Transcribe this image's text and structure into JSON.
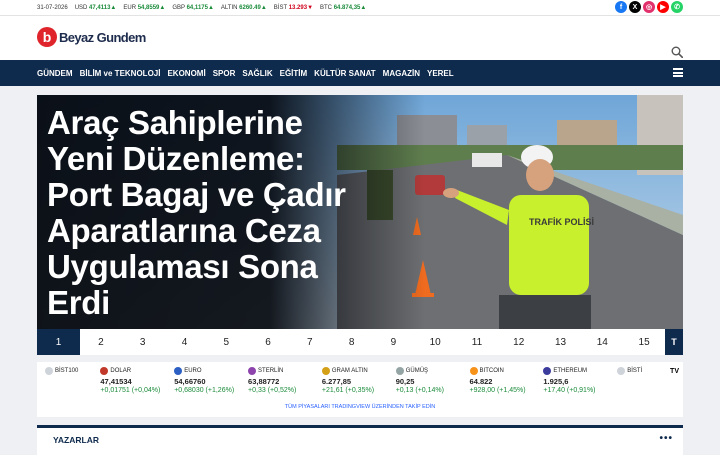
{
  "topbar": {
    "date": "31-07-2026",
    "tickers": [
      {
        "label": "USD",
        "value": "47,4113",
        "trend": "up"
      },
      {
        "label": "EUR",
        "value": "54,8559",
        "trend": "up"
      },
      {
        "label": "GBP",
        "value": "64,1175",
        "trend": "up"
      },
      {
        "label": "ALTIN",
        "value": "6260.49",
        "trend": "up"
      },
      {
        "label": "BİST",
        "value": "13.293",
        "trend": "down"
      },
      {
        "label": "BTC",
        "value": "64.874,35",
        "trend": "up"
      }
    ],
    "socials": [
      {
        "name": "facebook",
        "glyph": "f",
        "color": "#1877f2"
      },
      {
        "name": "x",
        "glyph": "X",
        "color": "#000000"
      },
      {
        "name": "instagram",
        "glyph": "◎",
        "color": "#e1306c"
      },
      {
        "name": "youtube",
        "glyph": "▶",
        "color": "#ff0000"
      },
      {
        "name": "whatsapp",
        "glyph": "✆",
        "color": "#25d366"
      }
    ]
  },
  "header": {
    "logo_letter": "b",
    "logo_text": "Beyaz Gundem",
    "search_icon": "search-icon"
  },
  "nav": {
    "items": [
      "GÜNDEM",
      "BİLİM ve TEKNOLOJİ",
      "EKONOMİ",
      "SPOR",
      "SAĞLIK",
      "EĞİTİM",
      "KÜLTÜR SANAT",
      "MAGAZİN",
      "YEREL"
    ],
    "menu_icon": "hamburger-icon"
  },
  "hero": {
    "title": "Araç Sahiplerine Yeni Düzenleme: Port Bagaj ve Çadır Aparatlarına Ceza Uygulaması Sona Erdi",
    "image_text": "TRAFİK POLİSİ"
  },
  "pager": {
    "pages": [
      "1",
      "2",
      "3",
      "4",
      "5",
      "6",
      "7",
      "8",
      "9",
      "10",
      "11",
      "12",
      "13",
      "14",
      "15"
    ],
    "active": "1",
    "end_label": "T"
  },
  "market": {
    "items": [
      {
        "name": "BİST100",
        "price": "",
        "change": "",
        "color": "#cfd3da"
      },
      {
        "name": "DOLAR",
        "price": "47,41534",
        "change": "+0,01751 (+0,04%)",
        "color": "#c0392b"
      },
      {
        "name": "EURO",
        "price": "54,66760",
        "change": "+0,68030 (+1,26%)",
        "color": "#2c5fc4"
      },
      {
        "name": "STERLİN",
        "price": "63,88772",
        "change": "+0,33 (+0,52%)",
        "color": "#8e44ad"
      },
      {
        "name": "GRAM ALTIN",
        "price": "6.277,85",
        "change": "+21,61 (+0,35%)",
        "color": "#d4a017"
      },
      {
        "name": "GÜMÜŞ",
        "price": "90,25",
        "change": "+0,13 (+0,14%)",
        "color": "#95a5a6"
      },
      {
        "name": "BITCOIN",
        "price": "64.822",
        "change": "+928,00 (+1,45%)",
        "color": "#f7931a"
      },
      {
        "name": "ETHEREUM",
        "price": "1.925,6",
        "change": "+17,40 (+0,91%)",
        "color": "#3c3c9d"
      },
      {
        "name": "BİSTİ",
        "price": "",
        "change": "",
        "color": "#cfd3da"
      }
    ],
    "tv_logo": "TV",
    "footer": "TÜM PİYASALARI TRADINGVIEW ÜZERİNDEN TAKİP EDİN"
  },
  "yazarlar": {
    "title": "YAZARLAR",
    "more": "•••"
  }
}
